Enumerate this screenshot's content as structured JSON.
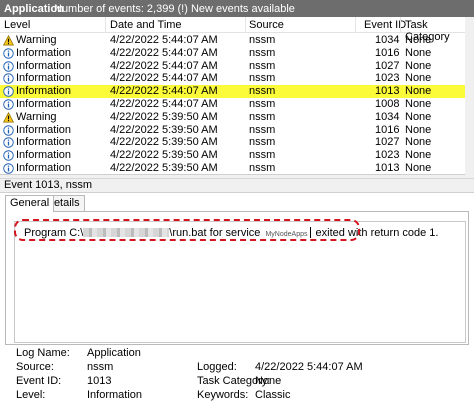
{
  "titlebar": {
    "app": "Application",
    "events_text": "Number of events: 2,399 (!) New events available"
  },
  "columns": {
    "level": "Level",
    "date": "Date and Time",
    "source": "Source",
    "event_id": "Event ID",
    "task": "Task Category"
  },
  "rows": [
    {
      "level": "Warning",
      "icon": "warning-icon",
      "date": "4/22/2022 5:44:07 AM",
      "source": "nssm",
      "event_id": "1034",
      "task": "None"
    },
    {
      "level": "Information",
      "icon": "info-icon",
      "date": "4/22/2022 5:44:07 AM",
      "source": "nssm",
      "event_id": "1016",
      "task": "None"
    },
    {
      "level": "Information",
      "icon": "info-icon",
      "date": "4/22/2022 5:44:07 AM",
      "source": "nssm",
      "event_id": "1027",
      "task": "None"
    },
    {
      "level": "Information",
      "icon": "info-icon",
      "date": "4/22/2022 5:44:07 AM",
      "source": "nssm",
      "event_id": "1023",
      "task": "None"
    },
    {
      "level": "Information",
      "icon": "info-icon",
      "date": "4/22/2022 5:44:07 AM",
      "source": "nssm",
      "event_id": "1013",
      "task": "None",
      "selected": true
    },
    {
      "level": "Information",
      "icon": "info-icon",
      "date": "4/22/2022 5:44:07 AM",
      "source": "nssm",
      "event_id": "1008",
      "task": "None"
    },
    {
      "level": "Warning",
      "icon": "warning-icon",
      "date": "4/22/2022 5:39:50 AM",
      "source": "nssm",
      "event_id": "1034",
      "task": "None"
    },
    {
      "level": "Information",
      "icon": "info-icon",
      "date": "4/22/2022 5:39:50 AM",
      "source": "nssm",
      "event_id": "1016",
      "task": "None"
    },
    {
      "level": "Information",
      "icon": "info-icon",
      "date": "4/22/2022 5:39:50 AM",
      "source": "nssm",
      "event_id": "1027",
      "task": "None"
    },
    {
      "level": "Information",
      "icon": "info-icon",
      "date": "4/22/2022 5:39:50 AM",
      "source": "nssm",
      "event_id": "1023",
      "task": "None"
    },
    {
      "level": "Information",
      "icon": "info-icon",
      "date": "4/22/2022 5:39:50 AM",
      "source": "nssm",
      "event_id": "1013",
      "task": "None"
    }
  ],
  "detail": {
    "title": "Event 1013, nssm",
    "tabs": [
      "General",
      "Details"
    ],
    "message": {
      "prefix": "Program C:\\",
      "middle": "\\run.bat for service",
      "service": "MyNodeApps",
      "suffix": "exited with return code 1."
    },
    "properties": {
      "log_name_label": "Log Name:",
      "log_name": "Application",
      "source_label": "Source:",
      "source": "nssm",
      "logged_label": "Logged:",
      "logged": "4/22/2022 5:44:07 AM",
      "event_id_label": "Event ID:",
      "event_id": "1013",
      "task_label": "Task Category:",
      "task": "None",
      "level_label": "Level:",
      "level": "Information",
      "keywords_label": "Keywords:",
      "keywords": "Classic"
    }
  },
  "colors": {
    "selected_row": "#fbfb3a",
    "annotation": "#d4141e",
    "warning": "#f5c518",
    "info": "#1f5fb4"
  }
}
